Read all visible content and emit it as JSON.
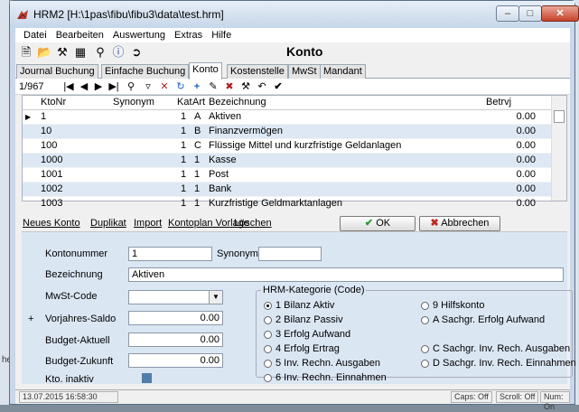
{
  "window": {
    "title": "HRM2  [H:\\1pas\\fibu\\fibu3\\data\\test.hrm]",
    "bg_text": "he"
  },
  "menu": [
    "Datei",
    "Bearbeiten",
    "Auswertung",
    "Extras",
    "Hilfe"
  ],
  "form_title": "Konto",
  "tabs": [
    "Journal Buchung",
    "Einfache Buchung",
    "Konto",
    "Kostenstelle",
    "MwSt",
    "Mandant"
  ],
  "active_tab": "Konto",
  "nav": {
    "record": "1/967"
  },
  "grid": {
    "columns": [
      "KtoNr",
      "Synonym",
      "Kat",
      "Art",
      "Bezeichnung",
      "Betrvj"
    ],
    "rows": [
      {
        "kto": "1",
        "syn": "",
        "kat": "1",
        "art": "A",
        "bez": "Aktiven",
        "betr": "0.00",
        "current": true
      },
      {
        "kto": "10",
        "syn": "",
        "kat": "1",
        "art": "B",
        "bez": "Finanzvermögen",
        "betr": "0.00"
      },
      {
        "kto": "100",
        "syn": "",
        "kat": "1",
        "art": "C",
        "bez": "Flüssige Mittel und kurzfristige Geldanlagen",
        "betr": "0.00"
      },
      {
        "kto": "1000",
        "syn": "",
        "kat": "1",
        "art": "1",
        "bez": "Kasse",
        "betr": "0.00"
      },
      {
        "kto": "1001",
        "syn": "",
        "kat": "1",
        "art": "1",
        "bez": "Post",
        "betr": "0.00"
      },
      {
        "kto": "1002",
        "syn": "",
        "kat": "1",
        "art": "1",
        "bez": "Bank",
        "betr": "0.00"
      },
      {
        "kto": "1003",
        "syn": "",
        "kat": "1",
        "art": "1",
        "bez": "Kurzfristige Geldmarktanlagen",
        "betr": "0.00"
      }
    ]
  },
  "actions": {
    "neues_konto": "Neues Konto",
    "duplikat": "Duplikat",
    "import": "Import",
    "kontoplan": "Kontoplan Vorlage",
    "loeschen": "Löschen",
    "ok": "OK",
    "abbrechen": "Abbrechen"
  },
  "detail": {
    "kontonummer_label": "Kontonummer",
    "kontonummer": "1",
    "synonym_label": "Synonym",
    "synonym": "",
    "bezeichnung_label": "Bezeichnung",
    "bezeichnung": "Aktiven",
    "mwst_label": "MwSt-Code",
    "mwst": "",
    "plus": "+",
    "vorjahres_label": "Vorjahres-Saldo",
    "vorjahres": "0.00",
    "budget_aktuell_label": "Budget-Aktuell",
    "budget_aktuell": "0.00",
    "budget_zukunft_label": "Budget-Zukunft",
    "budget_zukunft": "0.00",
    "inaktiv_label": "Kto. inaktiv",
    "kategorie_caption": "HRM-Kategorie (Code)",
    "kategorien": [
      {
        "label": "1 Bilanz Aktiv",
        "selected": true
      },
      {
        "label": "2 Bilanz Passiv"
      },
      {
        "label": "3 Erfolg Aufwand"
      },
      {
        "label": "4 Erfolg Ertrag"
      },
      {
        "label": "5 Inv. Rechn. Ausgaben"
      },
      {
        "label": "6 Inv. Rechn. Einnahmen"
      },
      {
        "label": "9 Hilfskonto"
      },
      {
        "label": "A  Sachgr. Erfolg Aufwand"
      },
      {
        "label": "C  Sachgr. Inv. Rech. Ausgaben"
      },
      {
        "label": "D  Sachgr. Inv. Rech. Einnahmen"
      }
    ]
  },
  "status": {
    "datetime": "13.07.2015  16:58:30",
    "caps": "Caps: Off",
    "scroll": "Scroll: Off",
    "num": "Num: On"
  }
}
